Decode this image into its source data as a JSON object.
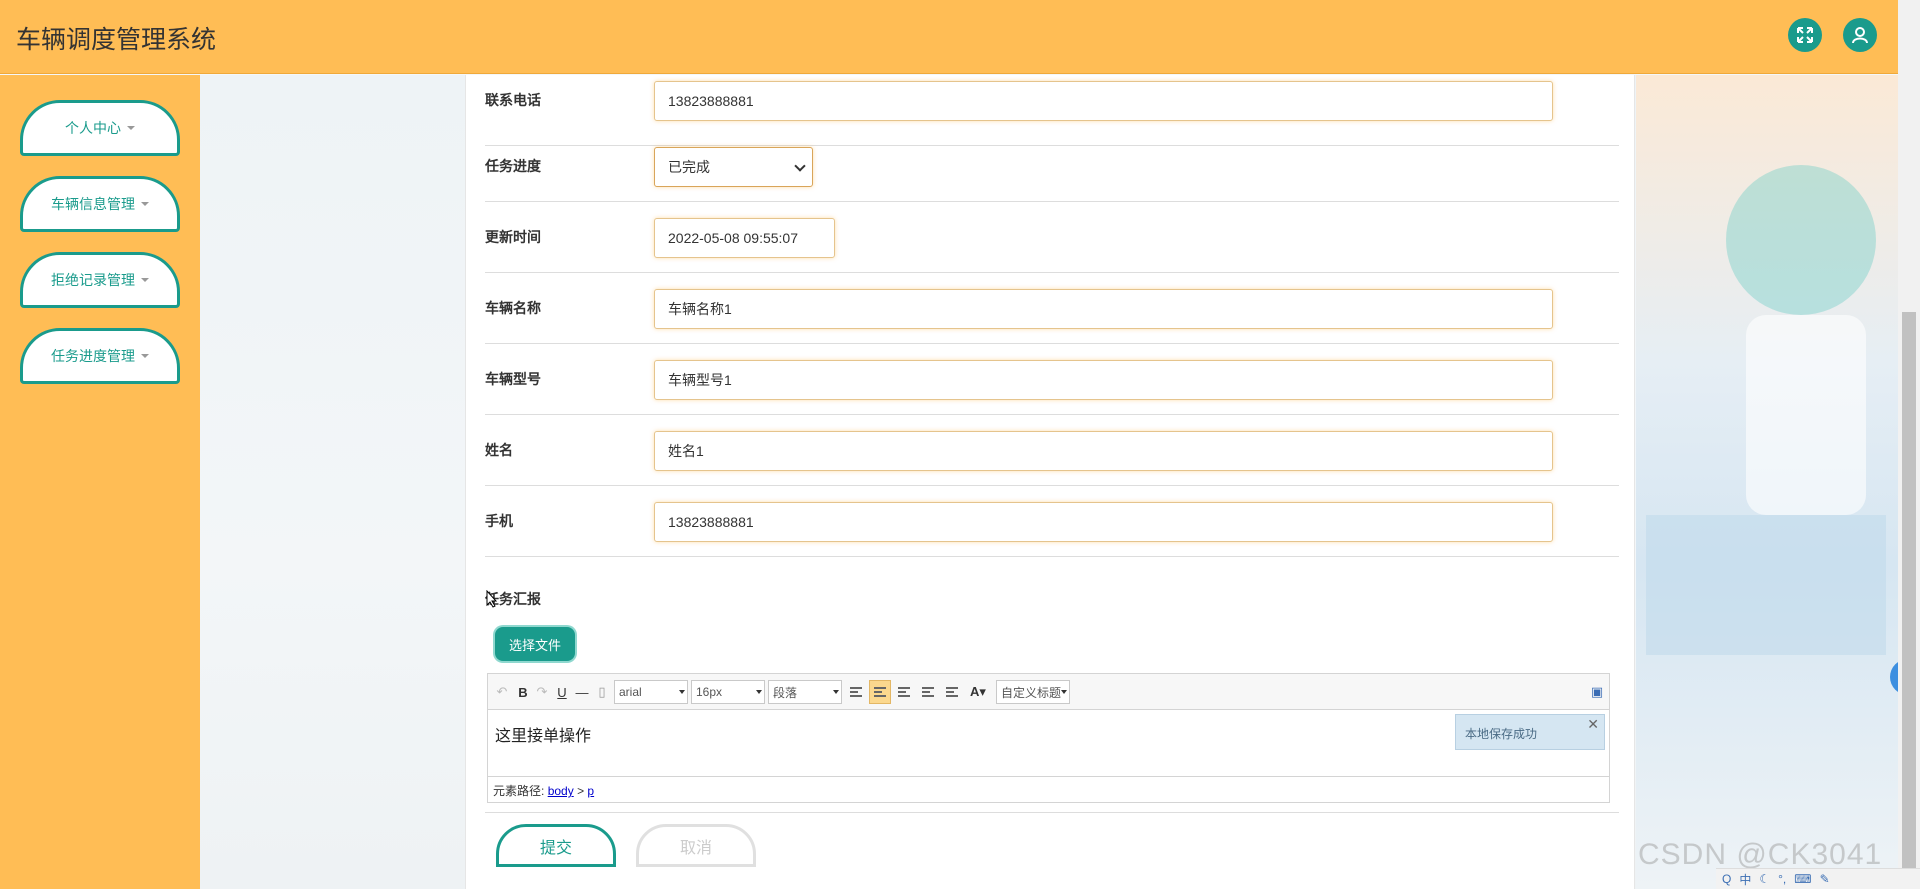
{
  "app": {
    "title": "车辆调度管理系统"
  },
  "header": {
    "fullscreen_icon": "expand-icon",
    "user_icon": "user-icon"
  },
  "sidebar": {
    "items": [
      {
        "label": "个人中心"
      },
      {
        "label": "车辆信息管理"
      },
      {
        "label": "拒绝记录管理"
      },
      {
        "label": "任务进度管理"
      }
    ]
  },
  "form": {
    "phone": {
      "label": "联系电话",
      "value": "13823888881"
    },
    "progress": {
      "label": "任务进度",
      "value": "已完成"
    },
    "updated": {
      "label": "更新时间",
      "value": "2022-05-08 09:55:07"
    },
    "vehicle_name": {
      "label": "车辆名称",
      "value": "车辆名称1"
    },
    "vehicle_model": {
      "label": "车辆型号",
      "value": "车辆型号1"
    },
    "name": {
      "label": "姓名",
      "value": "姓名1"
    },
    "mobile": {
      "label": "手机",
      "value": "13823888881"
    },
    "report": {
      "label": "任务汇报"
    }
  },
  "upload": {
    "label": "选择文件"
  },
  "editor": {
    "font_family": "arial",
    "font_size": "16px",
    "paragraph": "段落",
    "custom_title": "自定义标题",
    "content": "这里接单操作",
    "path_label": "元素路径:",
    "path_body": "body",
    "path_sep": ">",
    "path_p": "p",
    "toast": "本地保存成功"
  },
  "actions": {
    "submit": "提交",
    "cancel": "取消"
  },
  "watermark": "CSDN @CK3041",
  "tray": {
    "ime": "中"
  },
  "colors": {
    "accent": "#1a9b8c",
    "header": "#ffbd55"
  }
}
